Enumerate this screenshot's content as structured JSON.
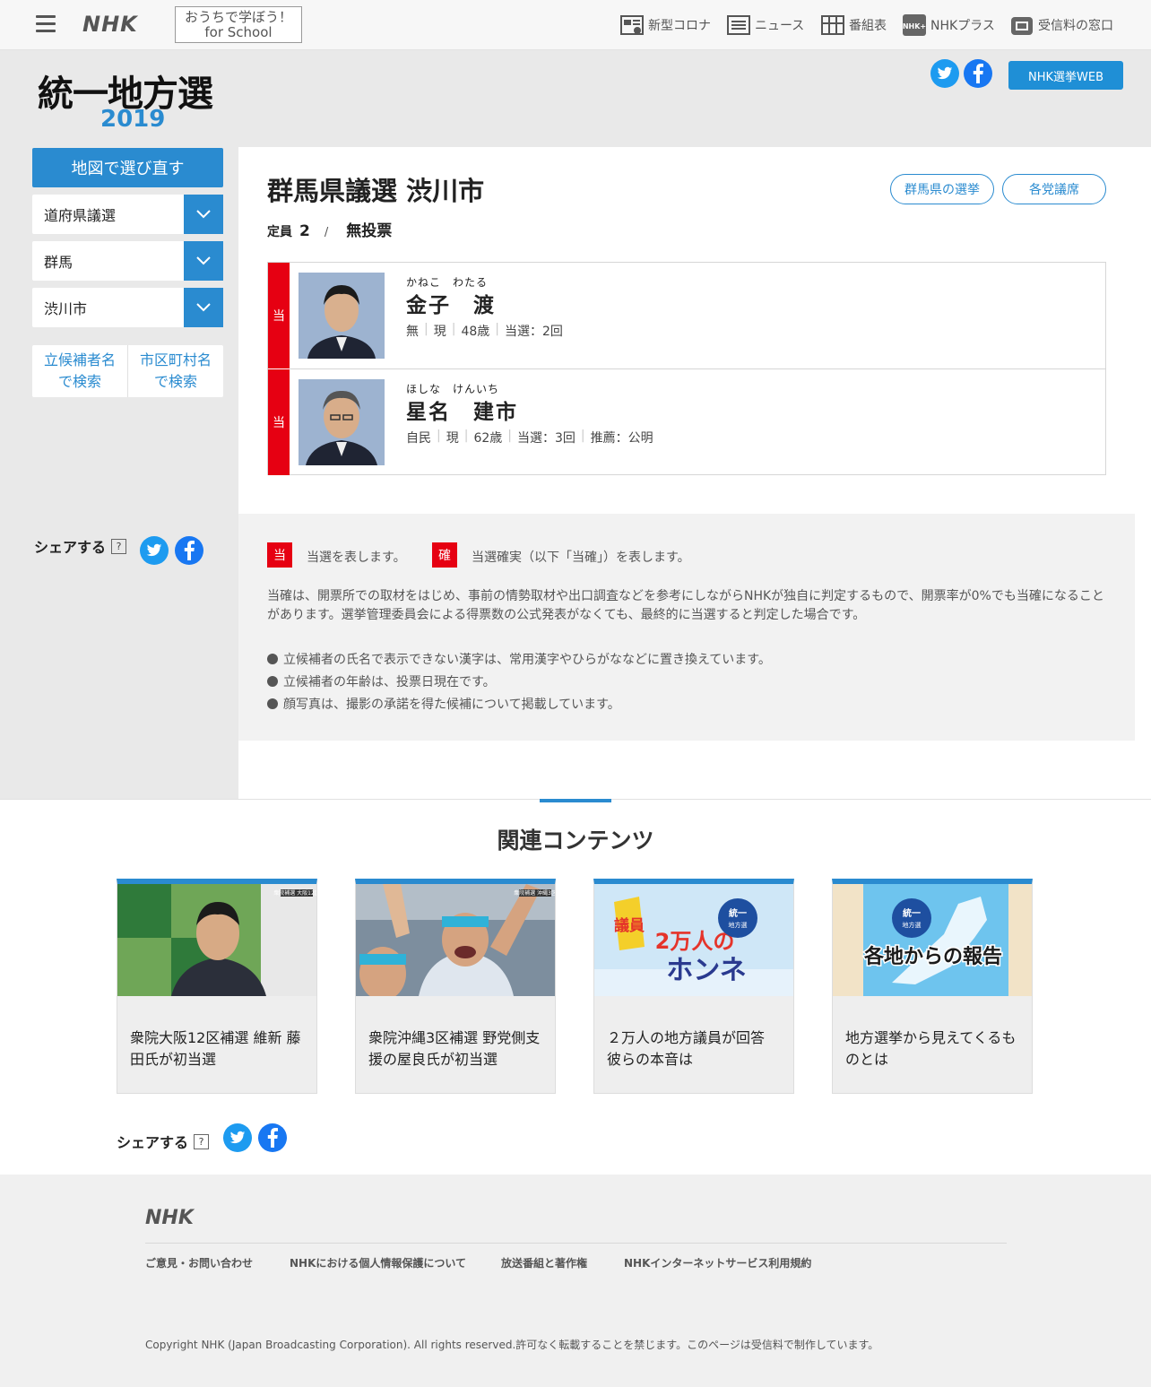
{
  "header": {
    "logo": "NHK",
    "school_line1": "おうちで学ぼう！",
    "school_line2": "for School",
    "nav": [
      {
        "label": "新型コロナ",
        "icon": "corona-icon"
      },
      {
        "label": "ニュース",
        "icon": "news-icon"
      },
      {
        "label": "番組表",
        "icon": "program-guide-icon"
      },
      {
        "label": "NHKプラス",
        "icon": "nhk-plus-icon"
      },
      {
        "label": "受信料の窓口",
        "icon": "reception-fee-icon"
      }
    ]
  },
  "hero": {
    "title": "統一地方選",
    "year": "2019",
    "web_button": "NHK選挙WEB"
  },
  "sidebar": {
    "map_button": "地図で選び直す",
    "selects": [
      "道府県議選",
      "群馬",
      "渋川市"
    ],
    "search_candidate": [
      "立候補者名",
      "で検索"
    ],
    "search_city": [
      "市区町村名",
      "で検索"
    ],
    "share_label": "シェアする",
    "help": "?"
  },
  "main": {
    "title": "群馬県議選 渋川市",
    "links": [
      "群馬県の選挙",
      "各党議席"
    ],
    "capacity_label": "定員",
    "capacity_value": "2",
    "separator": "/",
    "status": "無投票",
    "candidates": [
      {
        "badge": "当",
        "kana": "かねこ　わたる",
        "name": "金子　渡",
        "info": [
          "無",
          "現",
          "48歳",
          "当選：2回"
        ]
      },
      {
        "badge": "当",
        "kana": "ほしな　けんいち",
        "name": "星名　建市",
        "info": [
          "自民",
          "現",
          "62歳",
          "当選：3回",
          "推薦：公明"
        ]
      }
    ]
  },
  "legend": {
    "items": [
      {
        "badge": "当",
        "text": "当選を表します。"
      },
      {
        "badge": "確",
        "text": "当選確実（以下「当確」）を表します。"
      }
    ],
    "note": "当確は、開票所での取材をはじめ、事前の情勢取材や出口調査などを参考にしながらNHKが独自に判定するもので、開票率が0%でも当確になることがあります。選挙管理委員会による得票数の公式発表がなくても、最終的に当選すると判定した場合です。",
    "bullets": [
      "立候補者の氏名で表示できない漢字は、常用漢字やひらがななどに置き換えています。",
      "立候補者の年齢は、投票日現在です。",
      "顔写真は、撮影の承諾を得た候補について掲載しています。"
    ]
  },
  "related": {
    "title": "関連コンテンツ",
    "cards": [
      {
        "caption": "衆院大阪12区補選 維新 藤田氏が初当選",
        "thumb_label": "衆院補選 大阪12区"
      },
      {
        "caption": "衆院沖縄3区補選 野党側支援の屋良氏が初当選",
        "thumb_label": "衆院補選 沖縄3区"
      },
      {
        "caption": "２万人の地方議員が回答 彼らの本音は",
        "thumb_text_a": "議員",
        "thumb_text_b": "2万人の",
        "thumb_text_c": "ホンネ",
        "thumb_badge": [
          "統一",
          "地方選"
        ]
      },
      {
        "caption": "地方選挙から見えてくるものとは",
        "thumb_text": "各地からの報告",
        "thumb_badge": [
          "統一",
          "地方選"
        ]
      }
    ],
    "share_label": "シェアする",
    "help": "?"
  },
  "footer": {
    "logo": "NHK",
    "links": [
      "ご意見・お問い合わせ",
      "NHKにおける個人情報保護について",
      "放送番組と著作権",
      "NHKインターネットサービス利用規約"
    ],
    "copyright": "Copyright NHK (Japan Broadcasting Corporation). All rights reserved.許可なく転載することを禁じます。このページは受信料で制作しています。"
  },
  "colors": {
    "accent": "#2a8bd0",
    "win_red": "#e60012",
    "twitter": "#1d9bf0",
    "facebook": "#1877f2"
  }
}
